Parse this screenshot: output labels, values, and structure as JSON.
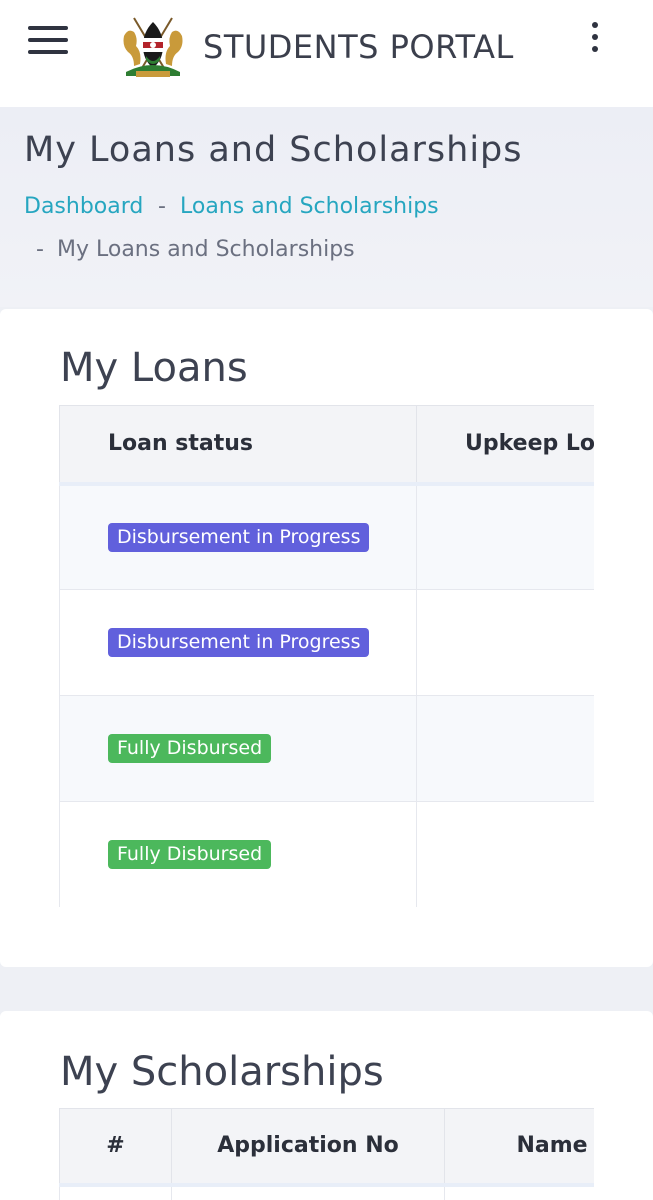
{
  "header": {
    "title": "STUDENTS PORTAL",
    "menu_icon": "hamburger-menu-icon",
    "more_icon": "vertical-dots-icon",
    "logo_motto": "HARAMBEE"
  },
  "page": {
    "title": "My Loans and Scholarships",
    "breadcrumb": {
      "items": [
        "Dashboard",
        "Loans and Scholarships"
      ],
      "separator": "-",
      "current": "My Loans and Scholarships"
    }
  },
  "loans": {
    "title": "My Loans",
    "columns": [
      "Loan status",
      "Upkeep Loa"
    ],
    "rows": [
      {
        "status": "Disbursement in Progress",
        "status_color": "#6160dc"
      },
      {
        "status": "Disbursement in Progress",
        "status_color": "#6160dc"
      },
      {
        "status": "Fully Disbursed",
        "status_color": "#4cb85c"
      },
      {
        "status": "Fully Disbursed",
        "status_color": "#4cb85c"
      }
    ]
  },
  "scholarships": {
    "title": "My Scholarships",
    "columns": [
      "#",
      "Application No",
      "Name"
    ]
  },
  "colors": {
    "link": "#26a6c0",
    "badge_progress": "#6160dc",
    "badge_disbursed": "#4cb85c"
  }
}
